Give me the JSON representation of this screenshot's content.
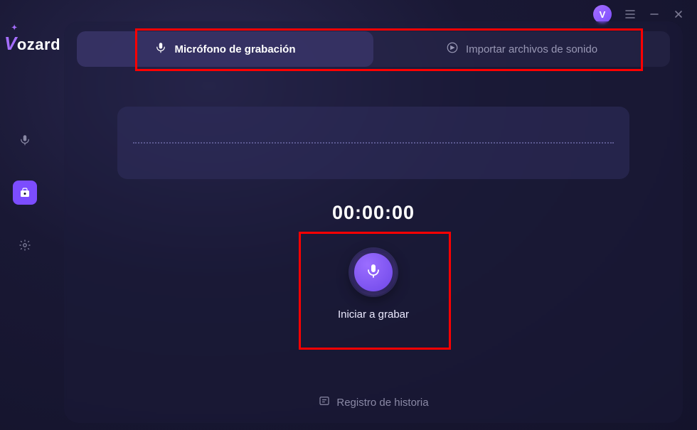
{
  "app_name": "Vozard",
  "avatar_letter": "V",
  "tabs": {
    "record": "Micrófono de grabación",
    "import": "Importar archivos de sonido"
  },
  "timer": "00:00:00",
  "record_button_label": "Iniciar a grabar",
  "history_label": "Registro de historia",
  "colors": {
    "accent": "#7c4dff",
    "highlight": "#ff0000"
  }
}
